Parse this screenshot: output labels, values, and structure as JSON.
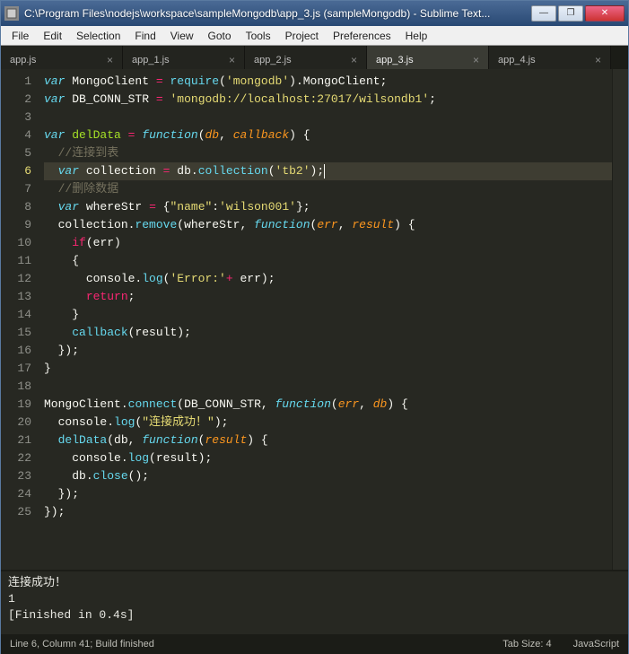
{
  "window": {
    "title": "C:\\Program Files\\nodejs\\workspace\\sampleMongodb\\app_3.js (sampleMongodb) - Sublime Text..."
  },
  "menu": {
    "items": [
      "File",
      "Edit",
      "Selection",
      "Find",
      "View",
      "Goto",
      "Tools",
      "Project",
      "Preferences",
      "Help"
    ]
  },
  "tabs": [
    {
      "label": "app.js",
      "active": false
    },
    {
      "label": "app_1.js",
      "active": false
    },
    {
      "label": "app_2.js",
      "active": false
    },
    {
      "label": "app_3.js",
      "active": true
    },
    {
      "label": "app_4.js",
      "active": false
    }
  ],
  "editor": {
    "current_line": 6,
    "lines": [
      {
        "n": 1,
        "tokens": [
          [
            "kw",
            "var"
          ],
          [
            "pl",
            " "
          ],
          [
            "pl",
            "MongoClient"
          ],
          [
            "pl",
            " "
          ],
          [
            "kw2",
            "="
          ],
          [
            "pl",
            " "
          ],
          [
            "call",
            "require"
          ],
          [
            "pl",
            "("
          ],
          [
            "str",
            "'mongodb'"
          ],
          [
            "pl",
            ")"
          ],
          [
            "pl",
            "."
          ],
          [
            "pl",
            "MongoClient"
          ],
          [
            "pl",
            ";"
          ]
        ]
      },
      {
        "n": 2,
        "tokens": [
          [
            "kw",
            "var"
          ],
          [
            "pl",
            " "
          ],
          [
            "pl",
            "DB_CONN_STR"
          ],
          [
            "pl",
            " "
          ],
          [
            "kw2",
            "="
          ],
          [
            "pl",
            " "
          ],
          [
            "str",
            "'mongodb://localhost:27017/wilsondb1'"
          ],
          [
            "pl",
            ";"
          ]
        ]
      },
      {
        "n": 3,
        "tokens": [
          [
            "pl",
            ""
          ]
        ]
      },
      {
        "n": 4,
        "tokens": [
          [
            "kw",
            "var"
          ],
          [
            "pl",
            " "
          ],
          [
            "fn",
            "delData"
          ],
          [
            "pl",
            " "
          ],
          [
            "kw2",
            "="
          ],
          [
            "pl",
            " "
          ],
          [
            "kw",
            "function"
          ],
          [
            "pl",
            "("
          ],
          [
            "param",
            "db"
          ],
          [
            "pl",
            ", "
          ],
          [
            "param",
            "callback"
          ],
          [
            "pl",
            ")"
          ],
          [
            "pl",
            " {"
          ]
        ]
      },
      {
        "n": 5,
        "tokens": [
          [
            "pl",
            "  "
          ],
          [
            "cmt",
            "//连接到表"
          ]
        ]
      },
      {
        "n": 6,
        "tokens": [
          [
            "pl",
            "  "
          ],
          [
            "kw",
            "var"
          ],
          [
            "pl",
            " "
          ],
          [
            "pl",
            "collection"
          ],
          [
            "pl",
            " "
          ],
          [
            "kw2",
            "="
          ],
          [
            "pl",
            " "
          ],
          [
            "pl",
            "db"
          ],
          [
            "pl",
            "."
          ],
          [
            "call",
            "collection"
          ],
          [
            "pl",
            "("
          ],
          [
            "str",
            "'tb2'"
          ],
          [
            "pl",
            ");"
          ]
        ]
      },
      {
        "n": 7,
        "tokens": [
          [
            "pl",
            "  "
          ],
          [
            "cmt",
            "//删除数据"
          ]
        ]
      },
      {
        "n": 8,
        "tokens": [
          [
            "pl",
            "  "
          ],
          [
            "kw",
            "var"
          ],
          [
            "pl",
            " "
          ],
          [
            "pl",
            "whereStr"
          ],
          [
            "pl",
            " "
          ],
          [
            "kw2",
            "="
          ],
          [
            "pl",
            " {"
          ],
          [
            "str",
            "\"name\""
          ],
          [
            "pl",
            ":"
          ],
          [
            "str",
            "'wilson001'"
          ],
          [
            "pl",
            "};"
          ]
        ]
      },
      {
        "n": 9,
        "tokens": [
          [
            "pl",
            "  "
          ],
          [
            "pl",
            "collection"
          ],
          [
            "pl",
            "."
          ],
          [
            "call",
            "remove"
          ],
          [
            "pl",
            "("
          ],
          [
            "pl",
            "whereStr"
          ],
          [
            "pl",
            ", "
          ],
          [
            "kw",
            "function"
          ],
          [
            "pl",
            "("
          ],
          [
            "param",
            "err"
          ],
          [
            "pl",
            ", "
          ],
          [
            "param",
            "result"
          ],
          [
            "pl",
            ")"
          ],
          [
            "pl",
            " {"
          ]
        ]
      },
      {
        "n": 10,
        "tokens": [
          [
            "pl",
            "    "
          ],
          [
            "kw2",
            "if"
          ],
          [
            "pl",
            "("
          ],
          [
            "pl",
            "err"
          ],
          [
            "pl",
            ")"
          ]
        ]
      },
      {
        "n": 11,
        "tokens": [
          [
            "pl",
            "    {"
          ]
        ]
      },
      {
        "n": 12,
        "tokens": [
          [
            "pl",
            "      "
          ],
          [
            "pl",
            "console"
          ],
          [
            "pl",
            "."
          ],
          [
            "call",
            "log"
          ],
          [
            "pl",
            "("
          ],
          [
            "str",
            "'Error:'"
          ],
          [
            "kw2",
            "+"
          ],
          [
            "pl",
            " err"
          ],
          [
            "pl",
            ");"
          ]
        ]
      },
      {
        "n": 13,
        "tokens": [
          [
            "pl",
            "      "
          ],
          [
            "kw2",
            "return"
          ],
          [
            "pl",
            ";"
          ]
        ]
      },
      {
        "n": 14,
        "tokens": [
          [
            "pl",
            "    }"
          ]
        ]
      },
      {
        "n": 15,
        "tokens": [
          [
            "pl",
            "    "
          ],
          [
            "call",
            "callback"
          ],
          [
            "pl",
            "("
          ],
          [
            "pl",
            "result"
          ],
          [
            "pl",
            ");"
          ]
        ]
      },
      {
        "n": 16,
        "tokens": [
          [
            "pl",
            "  });"
          ]
        ]
      },
      {
        "n": 17,
        "tokens": [
          [
            "pl",
            "}"
          ]
        ]
      },
      {
        "n": 18,
        "tokens": [
          [
            "pl",
            ""
          ]
        ]
      },
      {
        "n": 19,
        "tokens": [
          [
            "pl",
            "MongoClient"
          ],
          [
            "pl",
            "."
          ],
          [
            "call",
            "connect"
          ],
          [
            "pl",
            "("
          ],
          [
            "pl",
            "DB_CONN_STR"
          ],
          [
            "pl",
            ", "
          ],
          [
            "kw",
            "function"
          ],
          [
            "pl",
            "("
          ],
          [
            "param",
            "err"
          ],
          [
            "pl",
            ", "
          ],
          [
            "param",
            "db"
          ],
          [
            "pl",
            ")"
          ],
          [
            "pl",
            " {"
          ]
        ]
      },
      {
        "n": 20,
        "tokens": [
          [
            "pl",
            "  "
          ],
          [
            "pl",
            "console"
          ],
          [
            "pl",
            "."
          ],
          [
            "call",
            "log"
          ],
          [
            "pl",
            "("
          ],
          [
            "str",
            "\"连接成功！\""
          ],
          [
            "pl",
            ");"
          ]
        ]
      },
      {
        "n": 21,
        "tokens": [
          [
            "pl",
            "  "
          ],
          [
            "call",
            "delData"
          ],
          [
            "pl",
            "("
          ],
          [
            "pl",
            "db"
          ],
          [
            "pl",
            ", "
          ],
          [
            "kw",
            "function"
          ],
          [
            "pl",
            "("
          ],
          [
            "param",
            "result"
          ],
          [
            "pl",
            ")"
          ],
          [
            "pl",
            " {"
          ]
        ]
      },
      {
        "n": 22,
        "tokens": [
          [
            "pl",
            "    "
          ],
          [
            "pl",
            "console"
          ],
          [
            "pl",
            "."
          ],
          [
            "call",
            "log"
          ],
          [
            "pl",
            "("
          ],
          [
            "pl",
            "result"
          ],
          [
            "pl",
            ");"
          ]
        ]
      },
      {
        "n": 23,
        "tokens": [
          [
            "pl",
            "    "
          ],
          [
            "pl",
            "db"
          ],
          [
            "pl",
            "."
          ],
          [
            "call",
            "close"
          ],
          [
            "pl",
            "();"
          ]
        ]
      },
      {
        "n": 24,
        "tokens": [
          [
            "pl",
            "  });"
          ]
        ]
      },
      {
        "n": 25,
        "tokens": [
          [
            "pl",
            "});"
          ]
        ]
      }
    ]
  },
  "output": {
    "text": "连接成功！\n1\n[Finished in 0.4s]"
  },
  "status": {
    "left": "Line 6, Column 41; Build finished",
    "tab_size": "Tab Size: 4",
    "syntax": "JavaScript"
  }
}
